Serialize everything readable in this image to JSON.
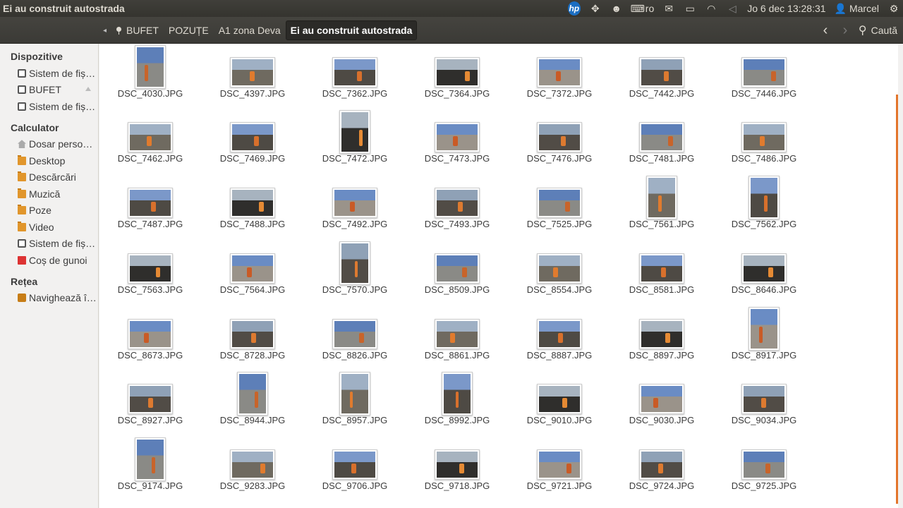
{
  "window_title": "Ei au construit autostrada",
  "top_panel": {
    "keyboard_layout": "ro",
    "clock": "Jo  6 dec 13:28:31",
    "user": "Marcel"
  },
  "breadcrumbs": [
    "BUFET",
    "POZUȚE",
    "A1 zona Deva",
    "Ei au construit autostrada"
  ],
  "search_label": "Caută",
  "sidebar": {
    "sections": [
      {
        "title": "Dispozitive",
        "items": [
          {
            "label": "Sistem de fiș…",
            "icon": "drive-icon"
          },
          {
            "label": "BUFET",
            "icon": "drive-icon",
            "eject": true
          },
          {
            "label": "Sistem de fiș…",
            "icon": "drive-icon"
          }
        ]
      },
      {
        "title": "Calculator",
        "items": [
          {
            "label": "Dosar perso…",
            "icon": "home-icon"
          },
          {
            "label": "Desktop",
            "icon": "folder-icon"
          },
          {
            "label": "Descărcări",
            "icon": "folder-icon"
          },
          {
            "label": "Muzică",
            "icon": "folder-icon"
          },
          {
            "label": "Poze",
            "icon": "folder-icon"
          },
          {
            "label": "Video",
            "icon": "folder-icon"
          },
          {
            "label": "Sistem de fiș…",
            "icon": "drive-icon"
          },
          {
            "label": "Coș de gunoi",
            "icon": "trash-icon"
          }
        ]
      },
      {
        "title": "Rețea",
        "items": [
          {
            "label": "Navighează î…",
            "icon": "network-icon"
          }
        ]
      }
    ]
  },
  "files": [
    "DSC_4030.JPG",
    "DSC_4397.JPG",
    "DSC_7362.JPG",
    "DSC_7364.JPG",
    "DSC_7372.JPG",
    "DSC_7442.JPG",
    "DSC_7446.JPG",
    "DSC_7462.JPG",
    "DSC_7469.JPG",
    "DSC_7472.JPG",
    "DSC_7473.JPG",
    "DSC_7476.JPG",
    "DSC_7481.JPG",
    "DSC_7486.JPG",
    "DSC_7487.JPG",
    "DSC_7488.JPG",
    "DSC_7492.JPG",
    "DSC_7493.JPG",
    "DSC_7525.JPG",
    "DSC_7561.JPG",
    "DSC_7562.JPG",
    "DSC_7563.JPG",
    "DSC_7564.JPG",
    "DSC_7570.JPG",
    "DSC_8509.JPG",
    "DSC_8554.JPG",
    "DSC_8581.JPG",
    "DSC_8646.JPG",
    "DSC_8673.JPG",
    "DSC_8728.JPG",
    "DSC_8826.JPG",
    "DSC_8861.JPG",
    "DSC_8887.JPG",
    "DSC_8897.JPG",
    "DSC_8917.JPG",
    "DSC_8927.JPG",
    "DSC_8944.JPG",
    "DSC_8957.JPG",
    "DSC_8992.JPG",
    "DSC_9010.JPG",
    "DSC_9030.JPG",
    "DSC_9034.JPG",
    "DSC_9174.JPG",
    "DSC_9283.JPG",
    "DSC_9706.JPG",
    "DSC_9718.JPG",
    "DSC_9721.JPG",
    "DSC_9724.JPG",
    "DSC_9725.JPG"
  ],
  "colors": {
    "panel_bg": "#3c3b37",
    "scrollbar_accent": "#e3752b",
    "folder_orange": "#e1962c"
  }
}
